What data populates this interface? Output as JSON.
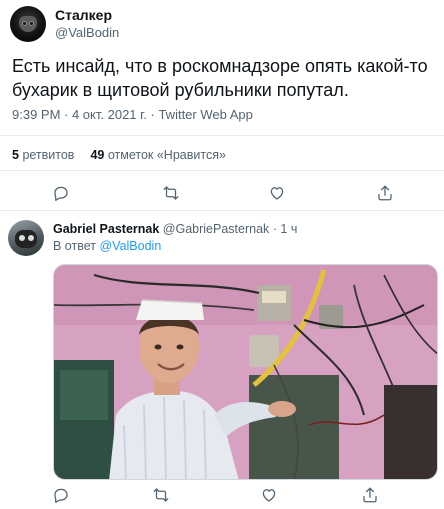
{
  "tweet": {
    "author_name": "Сталкер",
    "author_handle": "@ValBodin",
    "text": "Есть инсайд, что в роскомнадзоре опять какой-то бухарик в щитовой рубильники попутал.",
    "meta": "9:39 PM · 4 окт. 2021 г. · Twitter Web App",
    "retweets_count": "5",
    "retweets_label": "ретвитов",
    "likes_count": "49",
    "likes_label": "отметок «Нравится»"
  },
  "reply": {
    "author_name": "Gabriel Pasternak",
    "author_handle": "@GabriePasternak",
    "time": "· 1 ч",
    "reply_prefix": "В ответ",
    "reply_to": "@ValBodin"
  },
  "icons": [
    "reply-icon",
    "retweet-icon",
    "like-icon",
    "share-icon"
  ],
  "colors": {
    "link": "#1d9bf0",
    "secondary_text": "#536471",
    "primary_text": "#0f1419"
  }
}
